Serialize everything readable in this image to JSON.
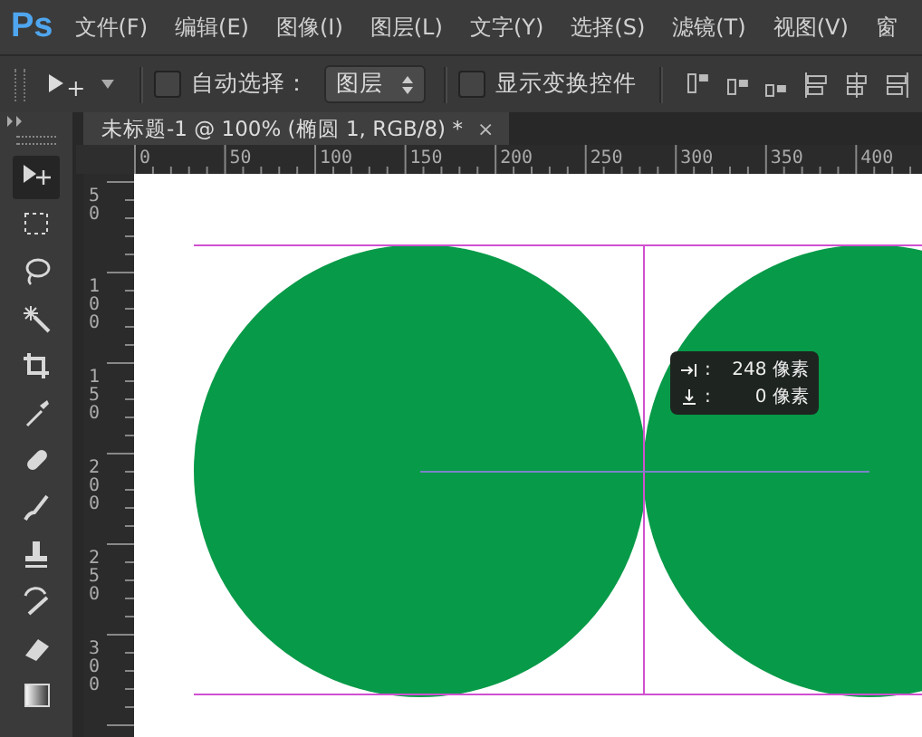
{
  "app": {
    "logo": "Ps"
  },
  "menu": [
    "文件(F)",
    "编辑(E)",
    "图像(I)",
    "图层(L)",
    "文字(Y)",
    "选择(S)",
    "滤镜(T)",
    "视图(V)",
    "窗"
  ],
  "options_bar": {
    "auto_select": {
      "label": "自动选择：",
      "checked": false
    },
    "target": {
      "value": "图层"
    },
    "show_transform": {
      "label": "显示变换控件",
      "checked": false
    }
  },
  "document_tab": {
    "title": "未标题-1 @ 100% (椭圆 1, RGB/8) *",
    "close": "×"
  },
  "horizontal_ruler": [
    "0",
    "50",
    "100",
    "150",
    "200",
    "250",
    "300",
    "350",
    "400"
  ],
  "vertical_ruler": [
    "50",
    "100",
    "150",
    "200",
    "250",
    "300"
  ],
  "tools": [
    {
      "kind": "move",
      "selected": true
    },
    {
      "kind": "marquee",
      "selected": false
    },
    {
      "kind": "lasso",
      "selected": false
    },
    {
      "kind": "wand",
      "selected": false
    },
    {
      "kind": "crop",
      "selected": false
    },
    {
      "kind": "eyedropper",
      "selected": false
    },
    {
      "kind": "healing",
      "selected": false
    },
    {
      "kind": "brush",
      "selected": false
    },
    {
      "kind": "stamp",
      "selected": false
    },
    {
      "kind": "history",
      "selected": false
    },
    {
      "kind": "eraser",
      "selected": false
    },
    {
      "kind": "gradient",
      "selected": false
    }
  ],
  "measure_tooltip": [
    {
      "kind": "horizontal",
      "separator": ":",
      "value": "248 像素"
    },
    {
      "kind": "vertical",
      "separator": ":",
      "value": "0 像素"
    }
  ]
}
